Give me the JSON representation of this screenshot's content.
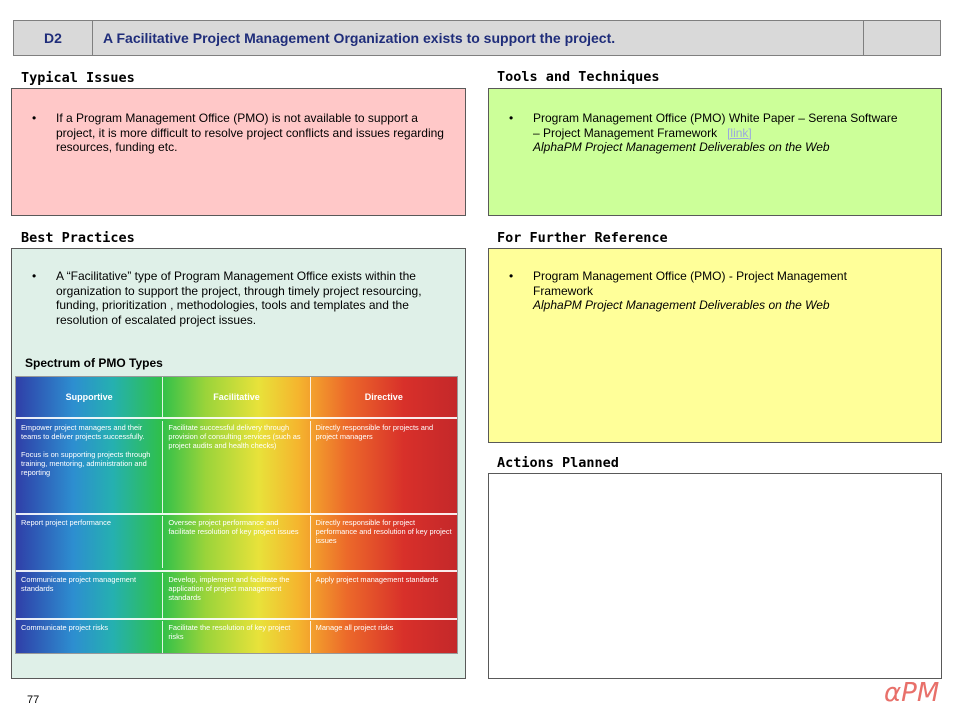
{
  "header": {
    "id": "D2",
    "title": "A Facilitative Project Management Organization exists to support the project."
  },
  "sections": {
    "typical_issues": {
      "label": "Typical Issues",
      "items": [
        "If a Program Management Office (PMO) is not available to support a project, it is more difficult to resolve project conflicts and issues regarding resources, funding etc."
      ]
    },
    "tools": {
      "label": "Tools and Techniques",
      "item_text": "Program Management Office (PMO)  White Paper – Serena Software – Project  Management Framework",
      "link": "[link]",
      "reference": "AlphaPM Project Management Deliverables on the Web"
    },
    "best_practices": {
      "label": "Best Practices",
      "items": [
        "A “Facilitative” type of Program Management  Office exists within the organization to support the project, through  timely project resourcing, funding, prioritization , methodologies, tools and templates and the resolution of escalated project issues."
      ]
    },
    "further_reference": {
      "label": "For Further Reference",
      "item_text": "Program Management Office (PMO) - Project Management Framework",
      "reference": "AlphaPM Project Management Deliverables on the Web"
    },
    "actions_planned": {
      "label": "Actions Planned"
    }
  },
  "spectrum": {
    "title": "Spectrum of PMO Types",
    "headers": [
      "Supportive",
      "Facilitative",
      "Directive"
    ],
    "rows": [
      [
        "Empower project managers and their teams to deliver projects successfully.\n\nFocus is on supporting projects through training, mentoring, administration and reporting",
        "Facilitate successful delivery through provision of  consulting services (such as project audits and health checks)",
        "Directly responsible for  projects and project managers"
      ],
      [
        "Report project performance",
        "Oversee project performance and facilitate resolution of key project issues",
        "Directly responsible for project performance and resolution of key project issues"
      ],
      [
        "Communicate project management standards",
        "Develop, implement and facilitate the application of  project management standards",
        "Apply project management standards"
      ],
      [
        "Communicate project risks",
        "Facilitate the resolution of key project risks",
        "Manage all project risks"
      ]
    ]
  },
  "footer": {
    "page_number": "77",
    "logo": "αPM"
  },
  "colors": {
    "typical_issues_bg": "#ffc8c8",
    "tools_bg": "#ccff99",
    "best_practices_bg": "#dff0e8",
    "further_reference_bg": "#ffff99",
    "actions_bg": "#ffffff",
    "header_text": "#1f2d7a"
  }
}
